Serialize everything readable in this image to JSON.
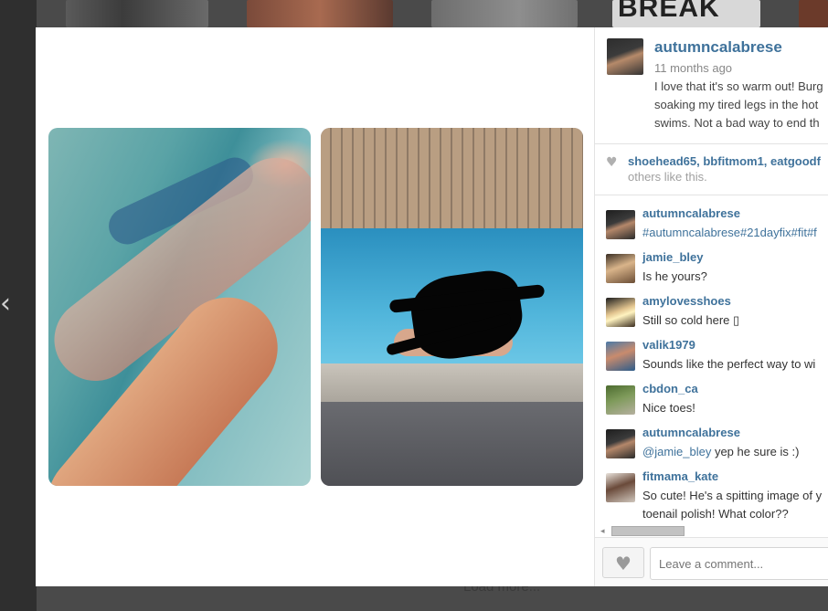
{
  "background": {
    "thumb4_text": "BREAK",
    "load_more": "Load more..."
  },
  "post": {
    "username": "autumncalabrese",
    "time": "11 months ago",
    "caption": "I love that it's so warm out! Burg… soaking my tired legs in the hot… swims. Not a bad way to end th…",
    "caption_lines": [
      "I love that it's so warm out! Burg",
      "soaking my tired legs in the hot",
      "swims. Not a bad way to end th"
    ]
  },
  "likes": {
    "users": "shoehead65, bbfitmom1, eatgoodf",
    "tail": "others like this."
  },
  "comments": [
    {
      "user": "autumncalabrese",
      "text": "#autumncalabrese#21dayfix#fit#f",
      "mention": "",
      "avatar": "av-ac"
    },
    {
      "user": "jamie_bley",
      "text": "Is he yours?",
      "mention": "",
      "avatar": "av-jb"
    },
    {
      "user": "amylovesshoes",
      "text": "Still so cold here ▯",
      "mention": "",
      "avatar": "av-al"
    },
    {
      "user": "valik1979",
      "text": "Sounds like the perfect way to wi",
      "mention": "",
      "avatar": "av-v"
    },
    {
      "user": "cbdon_ca",
      "text": "Nice toes!",
      "mention": "",
      "avatar": "av-cb"
    },
    {
      "user": "autumncalabrese",
      "text": " yep he sure is :)",
      "mention": "@jamie_bley",
      "avatar": "av-ac"
    },
    {
      "user": "fitmama_kate",
      "text": "So cute! He's a spitting image of y",
      "text2": "toenail polish! What color??",
      "mention": "",
      "avatar": "av-fk"
    }
  ],
  "comment_input": {
    "placeholder": "Leave a comment..."
  },
  "icons": {
    "heart": "heart-icon",
    "prev": "chevron-left-icon"
  },
  "colors": {
    "link": "#3f729b",
    "overlay": "#3a3a3a"
  }
}
